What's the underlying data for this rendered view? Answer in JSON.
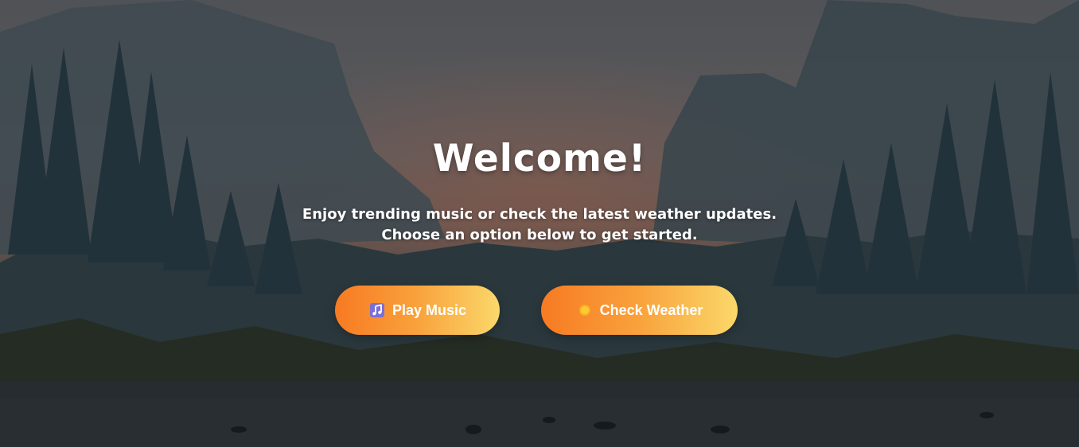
{
  "hero": {
    "title": "Welcome!",
    "subtitle_line1": "Enjoy trending music or check the latest weather updates.",
    "subtitle_line2": "Choose an option below to get started."
  },
  "buttons": {
    "music": {
      "label": "Play Music",
      "icon": "music-note-icon"
    },
    "weather": {
      "label": "Check Weather",
      "icon": "sun-icon"
    }
  },
  "colors": {
    "button_gradient_start": "#f77a22",
    "button_gradient_end": "#fbd86a",
    "text": "#ffffff"
  }
}
